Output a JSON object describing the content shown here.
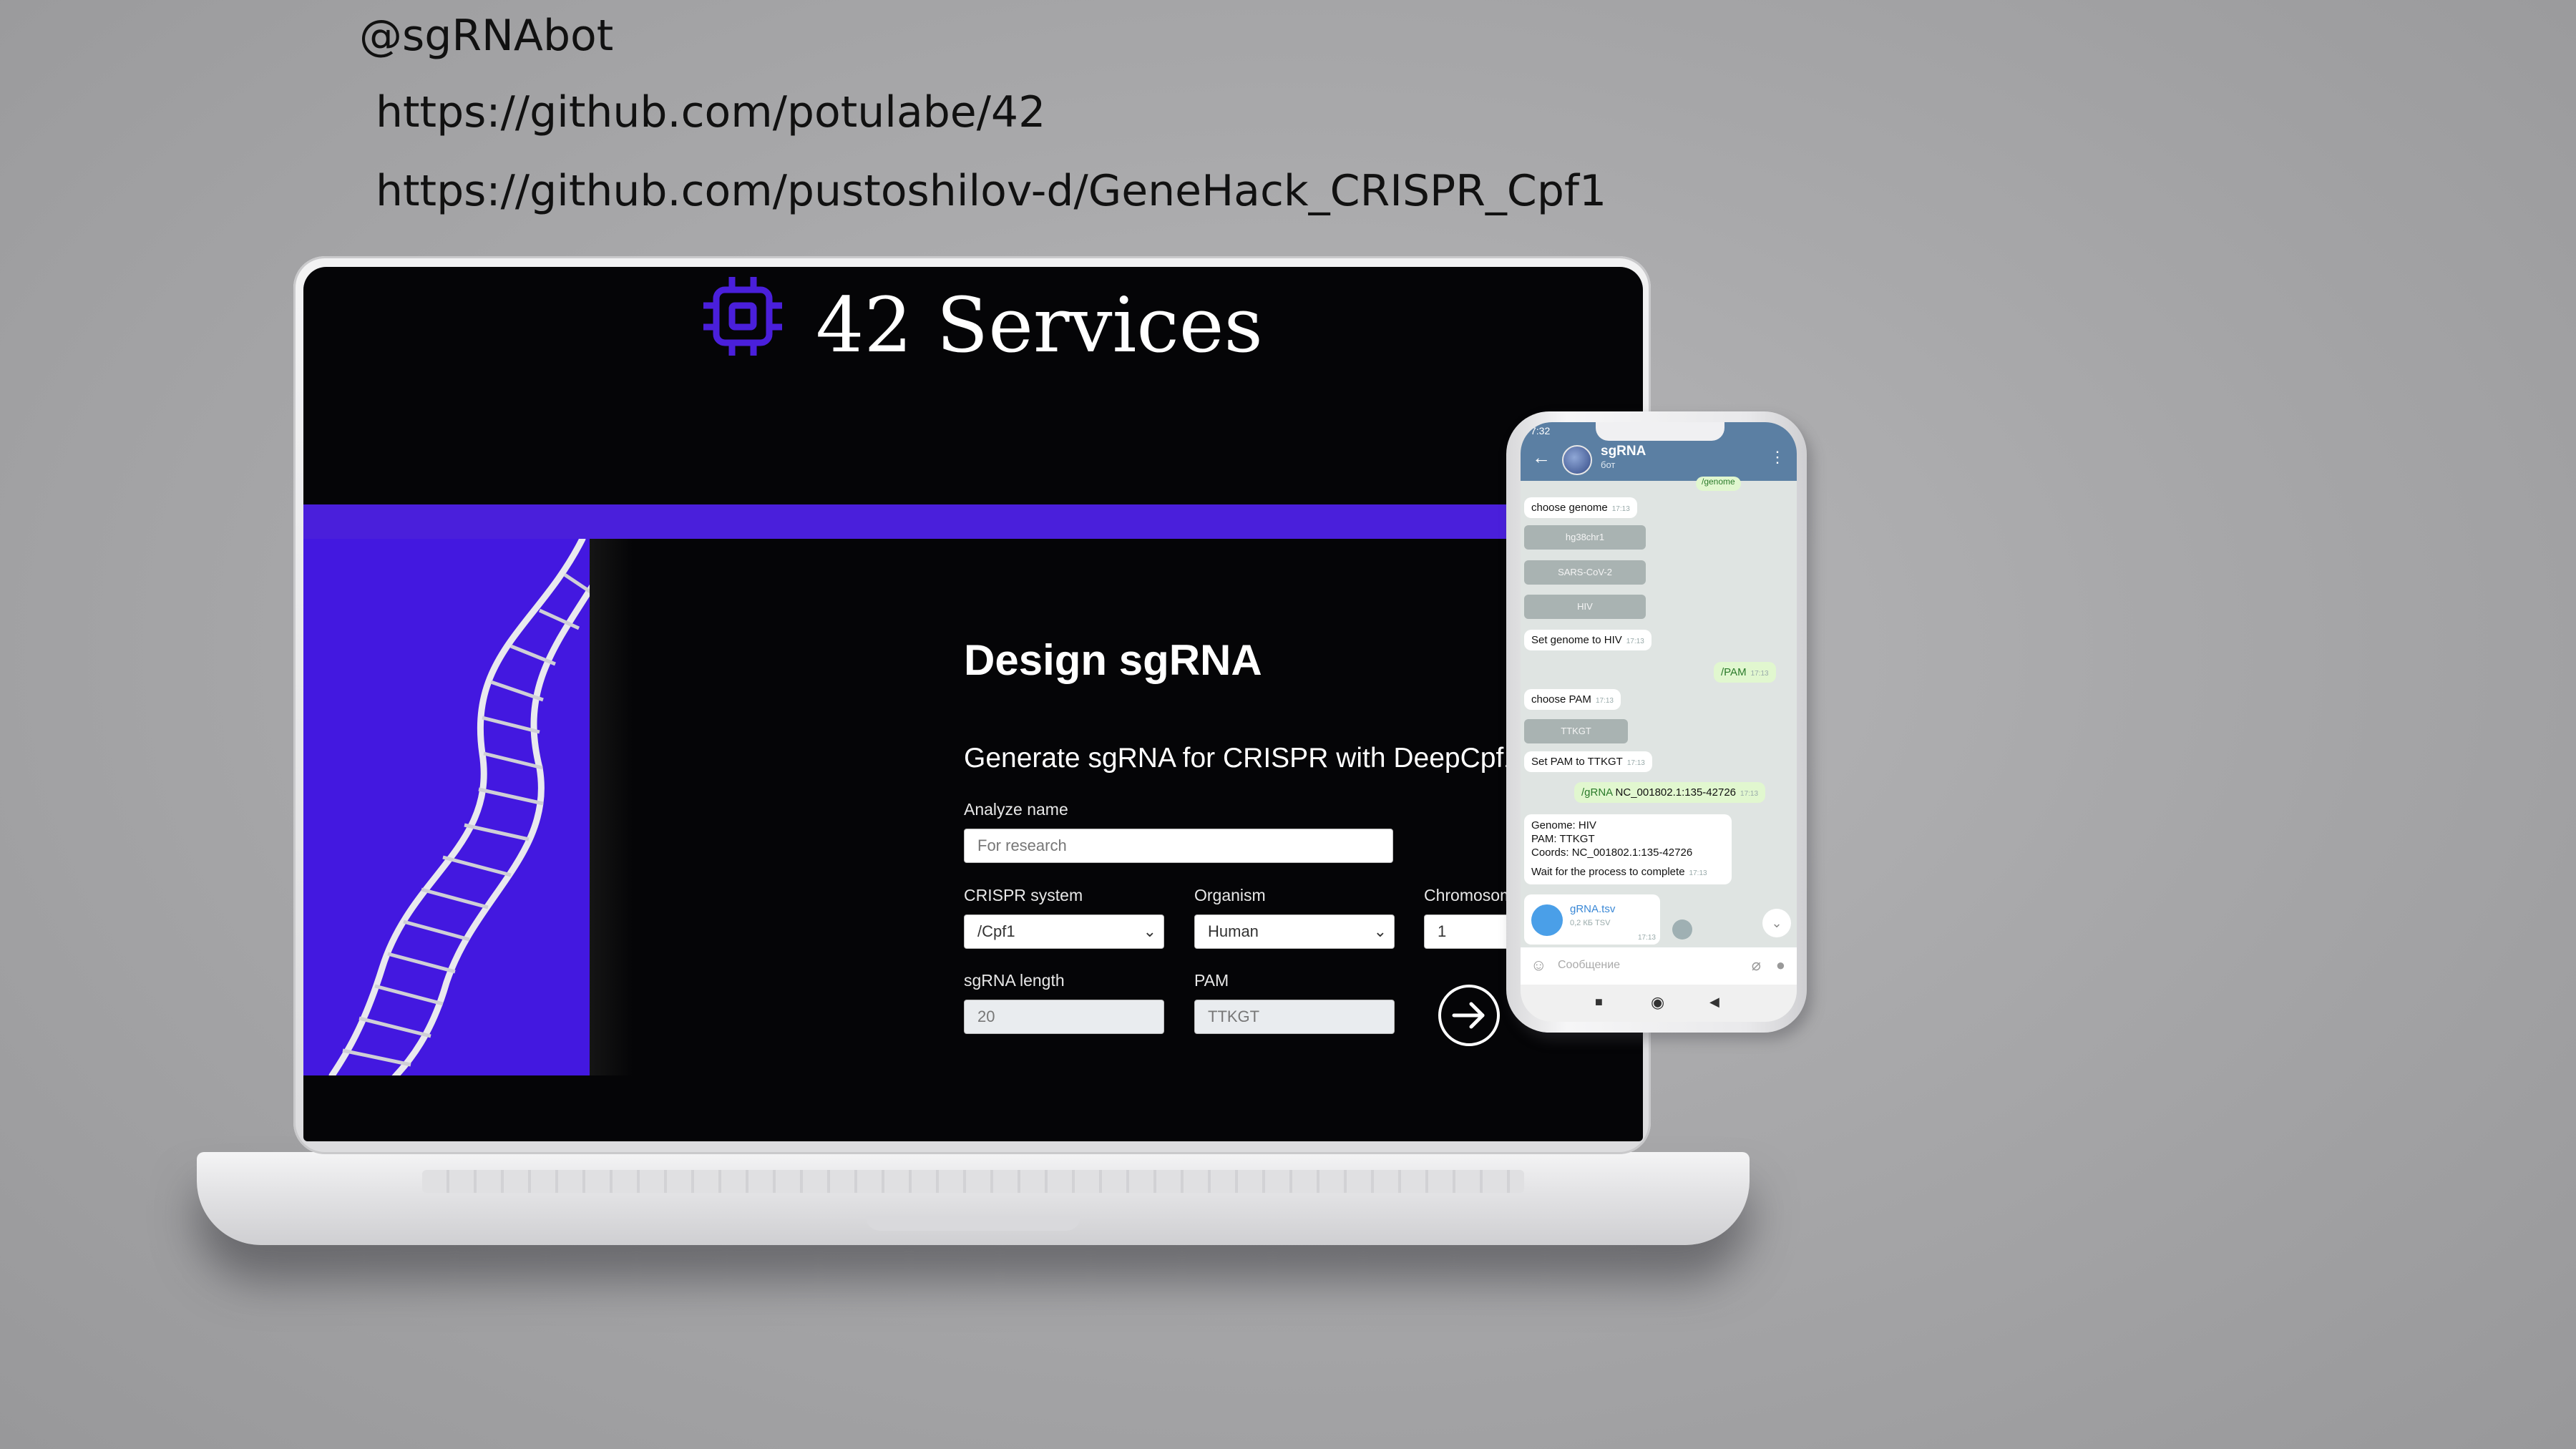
{
  "slide": {
    "handle": "@sgRNAbot",
    "link1": "https://github.com/potulabe/42",
    "link2": "https://github.com/pustoshilov-d/GeneHack_CRISPR_Cpf1"
  },
  "webapp": {
    "brand": "42 Services",
    "accent_color": "#4a1fdb",
    "form_title": "Design sgRNA",
    "subtitle": "Generate sgRNA for CRISPR with DeepCpf1",
    "analyze_label": "Analyze name",
    "analyze_placeholder": "For research",
    "crispr_label": "CRISPR system",
    "crispr_value": "/Cpf1",
    "organism_label": "Organism",
    "organism_value": "Human",
    "chromosome_label": "Chromosom",
    "chromosome_value": "1",
    "sgrna_length_label": "sgRNA length",
    "sgrna_length_value": "20",
    "pam_label": "PAM",
    "pam_value": "TTKGT",
    "submit_icon": "arrow-right-icon"
  },
  "telegram": {
    "time": "7:32",
    "chat_title": "sgRNA",
    "chat_status": "бот",
    "header_color": "#5b7fa3",
    "top_partial": "/genome",
    "messages": {
      "choose_genome": "choose genome",
      "choose_genome_time": "17:13",
      "kbd_hg38": "hg38chr1",
      "kbd_sars": "SARS-CoV-2",
      "kbd_hiv": "HIV",
      "set_genome": "Set genome to HIV",
      "set_genome_time": "17:13",
      "pam_cmd": "/PAM",
      "pam_cmd_time": "17:13",
      "choose_pam": "choose PAM",
      "choose_pam_time": "17:13",
      "kbd_ttkgt": "TTKGT",
      "set_pam": "Set PAM to TTKGT",
      "set_pam_time": "17:13",
      "grna_cmd": "/gRNA",
      "grna_coords": "NC_001802.1:135-42726",
      "grna_time": "17:13",
      "summary_genome": "Genome: HIV",
      "summary_pam": "PAM: TTKGT",
      "summary_coords": "Coords: NC_001802.1:135-42726",
      "summary_wait": "Wait for the process to complete",
      "summary_time": "17:13",
      "file_name": "gRNA.tsv",
      "file_size": "0,2 КБ TSV",
      "file_time": "17:13"
    },
    "input_placeholder": "Сообщение"
  }
}
